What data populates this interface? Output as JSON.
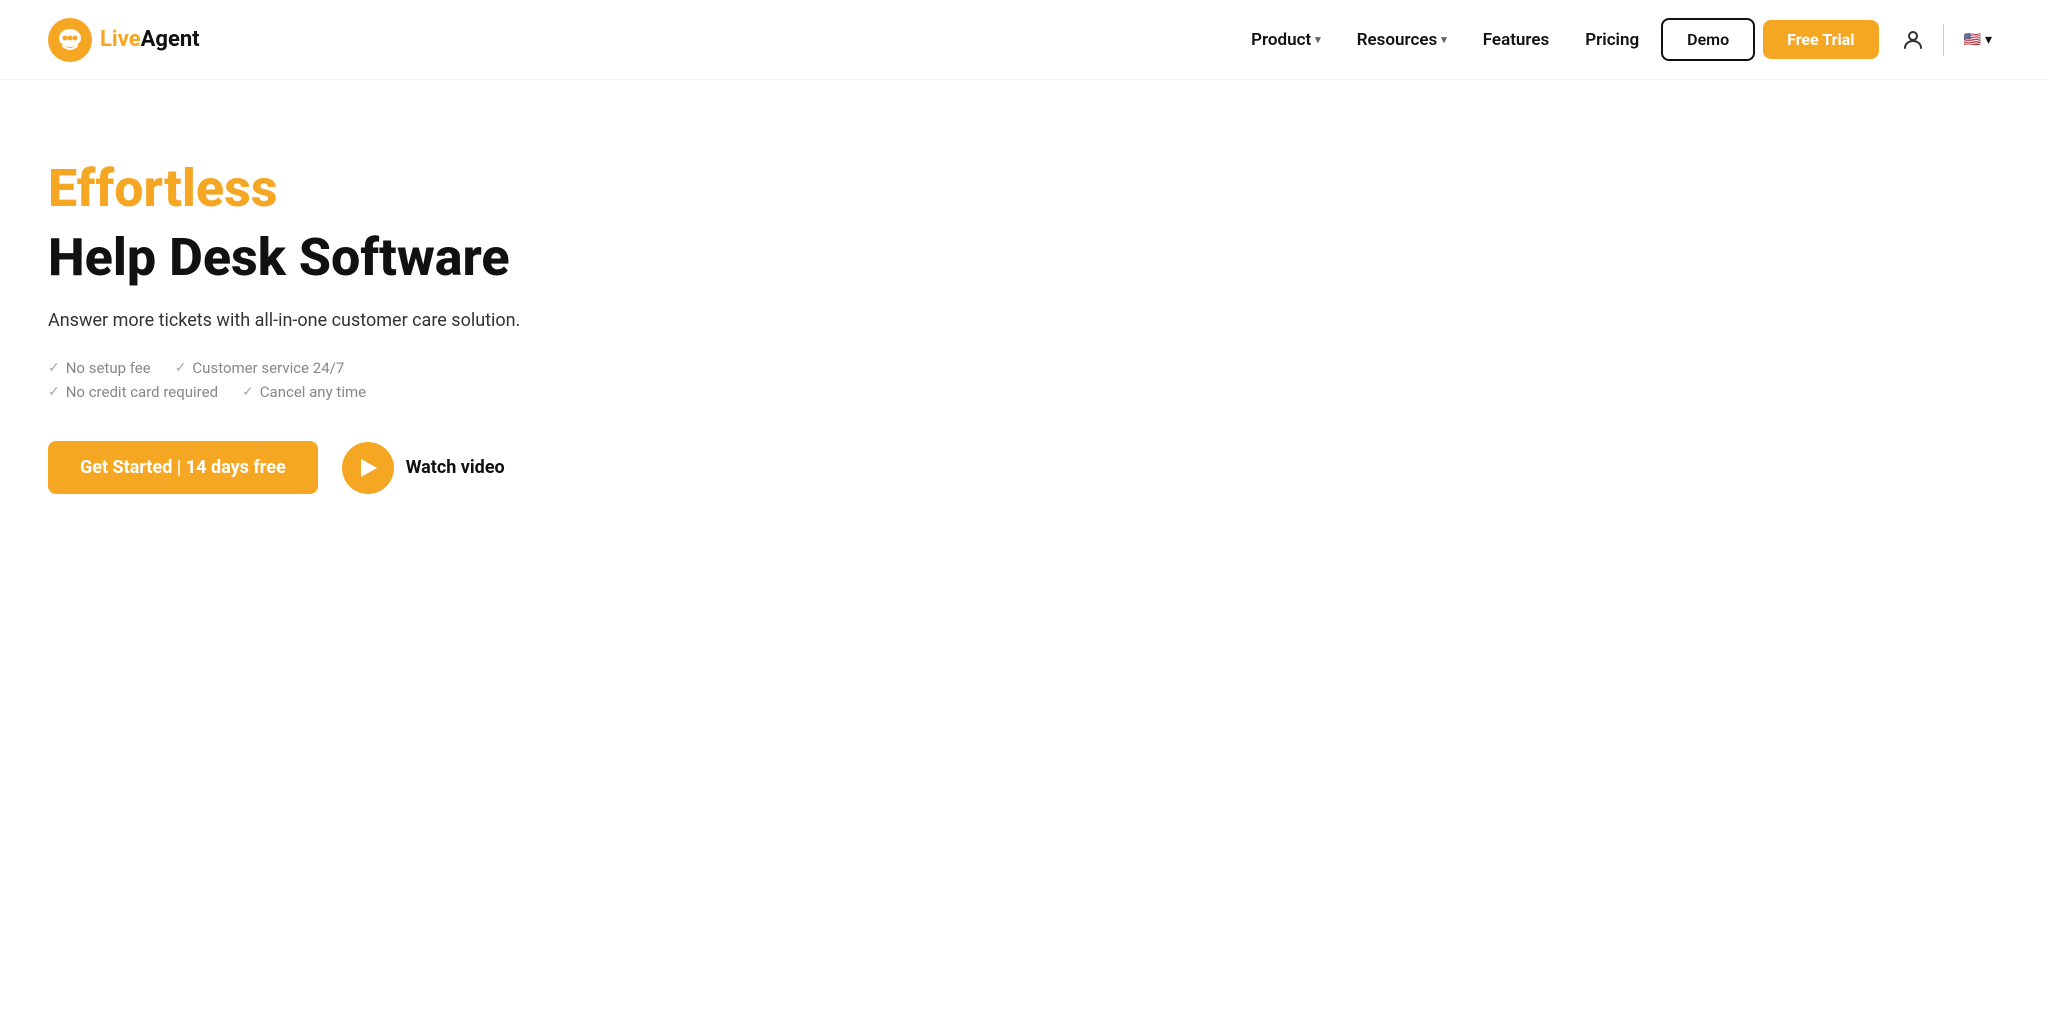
{
  "nav": {
    "logo_live": "Live",
    "logo_agent": "Agent",
    "links": [
      {
        "label": "Product",
        "has_dropdown": true
      },
      {
        "label": "Resources",
        "has_dropdown": true
      },
      {
        "label": "Features",
        "has_dropdown": false
      },
      {
        "label": "Pricing",
        "has_dropdown": false
      }
    ],
    "demo_label": "Demo",
    "free_trial_label": "Free Trial",
    "language_flag": "🇺🇸",
    "chevron": "▾"
  },
  "hero": {
    "tagline": "Effortless",
    "title": "Help Desk Software",
    "subtitle": "Answer more tickets with all-in-one customer care solution.",
    "checks": [
      {
        "row": 0,
        "label": "No setup fee"
      },
      {
        "row": 0,
        "label": "Customer service 24/7"
      },
      {
        "row": 1,
        "label": "No credit card required"
      },
      {
        "row": 1,
        "label": "Cancel any time"
      }
    ],
    "get_started_label": "Get Started | 14 days free",
    "watch_video_label": "Watch video"
  }
}
